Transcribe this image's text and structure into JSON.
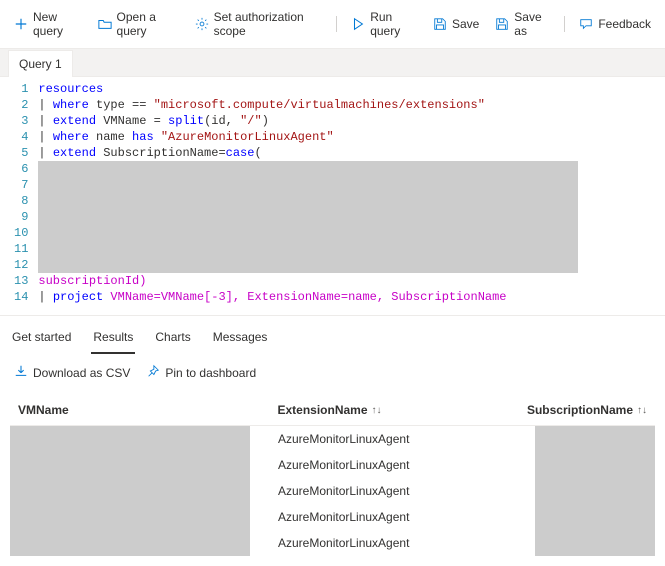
{
  "toolbar": {
    "new_query": "New query",
    "open_query": "Open a query",
    "set_scope": "Set authorization scope",
    "run_query": "Run query",
    "save": "Save",
    "save_as": "Save as",
    "feedback": "Feedback"
  },
  "tab": {
    "label": "Query 1"
  },
  "editor": {
    "lines": [
      "1",
      "2",
      "3",
      "4",
      "5",
      "6",
      "7",
      "8",
      "9",
      "10",
      "11",
      "12",
      "13",
      "14"
    ],
    "l1_a": "resources",
    "l2_pipe": "| ",
    "l2_kw": "where",
    "l2_rest": " type == ",
    "l2_str": "\"microsoft.compute/virtualmachines/extensions\"",
    "l3_pipe": "| ",
    "l3_kw": "extend",
    "l3_a": " VMName = ",
    "l3_fn": "split",
    "l3_b": "(id, ",
    "l3_str": "\"/\"",
    "l3_c": ")",
    "l4_pipe": "| ",
    "l4_kw": "where",
    "l4_a": " name ",
    "l4_kw2": "has",
    "l4_b": " ",
    "l4_str": "\"AzureMonitorLinuxAgent\"",
    "l5_pipe": "| ",
    "l5_kw": "extend",
    "l5_a": " SubscriptionName=",
    "l5_fn": "case",
    "l5_b": "(",
    "l13_a": "subscriptionId)",
    "l14_pipe": "| ",
    "l14_kw": "project",
    "l14_a": " VMName=VMName[-3], ExtensionName=name, SubscriptionName"
  },
  "resultTabs": {
    "get_started": "Get started",
    "results": "Results",
    "charts": "Charts",
    "messages": "Messages"
  },
  "resultActions": {
    "download_csv": "Download as CSV",
    "pin_dashboard": "Pin to dashboard"
  },
  "grid": {
    "headers": {
      "vm": "VMName",
      "ext": "ExtensionName",
      "sub": "SubscriptionName"
    },
    "rows": [
      {
        "ext": "AzureMonitorLinuxAgent"
      },
      {
        "ext": "AzureMonitorLinuxAgent"
      },
      {
        "ext": "AzureMonitorLinuxAgent"
      },
      {
        "ext": "AzureMonitorLinuxAgent"
      },
      {
        "ext": "AzureMonitorLinuxAgent"
      }
    ]
  },
  "chart_data": {
    "type": "table",
    "columns": [
      "VMName",
      "ExtensionName",
      "SubscriptionName"
    ],
    "rows": [
      [
        null,
        "AzureMonitorLinuxAgent",
        null
      ],
      [
        null,
        "AzureMonitorLinuxAgent",
        null
      ],
      [
        null,
        "AzureMonitorLinuxAgent",
        null
      ],
      [
        null,
        "AzureMonitorLinuxAgent",
        null
      ],
      [
        null,
        "AzureMonitorLinuxAgent",
        null
      ]
    ]
  }
}
